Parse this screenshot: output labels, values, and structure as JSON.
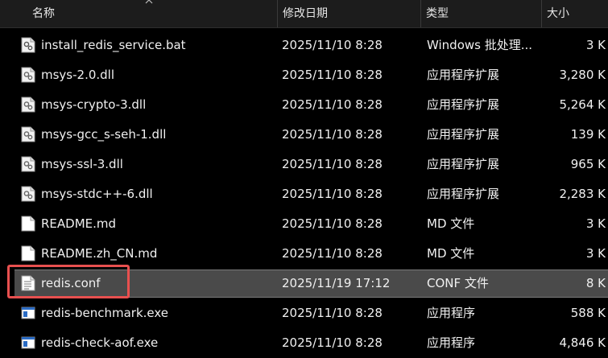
{
  "columns": {
    "name": "名称",
    "date": "修改日期",
    "type": "类型",
    "size": "大小"
  },
  "files": [
    {
      "name": "install_redis_service.bat",
      "date": "2025/11/10 8:28",
      "type": "Windows 批处理...",
      "size": "3 K",
      "icon": "batch-file-icon"
    },
    {
      "name": "msys-2.0.dll",
      "date": "2025/11/10 8:28",
      "type": "应用程序扩展",
      "size": "3,280 K",
      "icon": "dll-file-icon"
    },
    {
      "name": "msys-crypto-3.dll",
      "date": "2025/11/10 8:28",
      "type": "应用程序扩展",
      "size": "5,264 K",
      "icon": "dll-file-icon"
    },
    {
      "name": "msys-gcc_s-seh-1.dll",
      "date": "2025/11/10 8:28",
      "type": "应用程序扩展",
      "size": "139 K",
      "icon": "dll-file-icon"
    },
    {
      "name": "msys-ssl-3.dll",
      "date": "2025/11/10 8:28",
      "type": "应用程序扩展",
      "size": "965 K",
      "icon": "dll-file-icon"
    },
    {
      "name": "msys-stdc++-6.dll",
      "date": "2025/11/10 8:28",
      "type": "应用程序扩展",
      "size": "2,283 K",
      "icon": "dll-file-icon"
    },
    {
      "name": "README.md",
      "date": "2025/11/10 8:28",
      "type": "MD 文件",
      "size": "3 K",
      "icon": "document-file-icon"
    },
    {
      "name": "README.zh_CN.md",
      "date": "2025/11/10 8:28",
      "type": "MD 文件",
      "size": "3 K",
      "icon": "document-file-icon"
    },
    {
      "name": "redis.conf",
      "date": "2025/11/19 17:12",
      "type": "CONF 文件",
      "size": "8 K",
      "icon": "text-file-icon",
      "selected": true
    },
    {
      "name": "redis-benchmark.exe",
      "date": "2025/11/10 8:28",
      "type": "应用程序",
      "size": "588 K",
      "icon": "exe-file-icon"
    },
    {
      "name": "redis-check-aof.exe",
      "date": "2025/11/10 8:28",
      "type": "应用程序",
      "size": "4,846 K",
      "icon": "exe-file-icon"
    }
  ],
  "colors": {
    "background": "#000000",
    "header": "#1c1c1c",
    "selected_row": "#4a4a4a",
    "highlight_box": "#e8504f",
    "text": "#f0f0f0"
  }
}
